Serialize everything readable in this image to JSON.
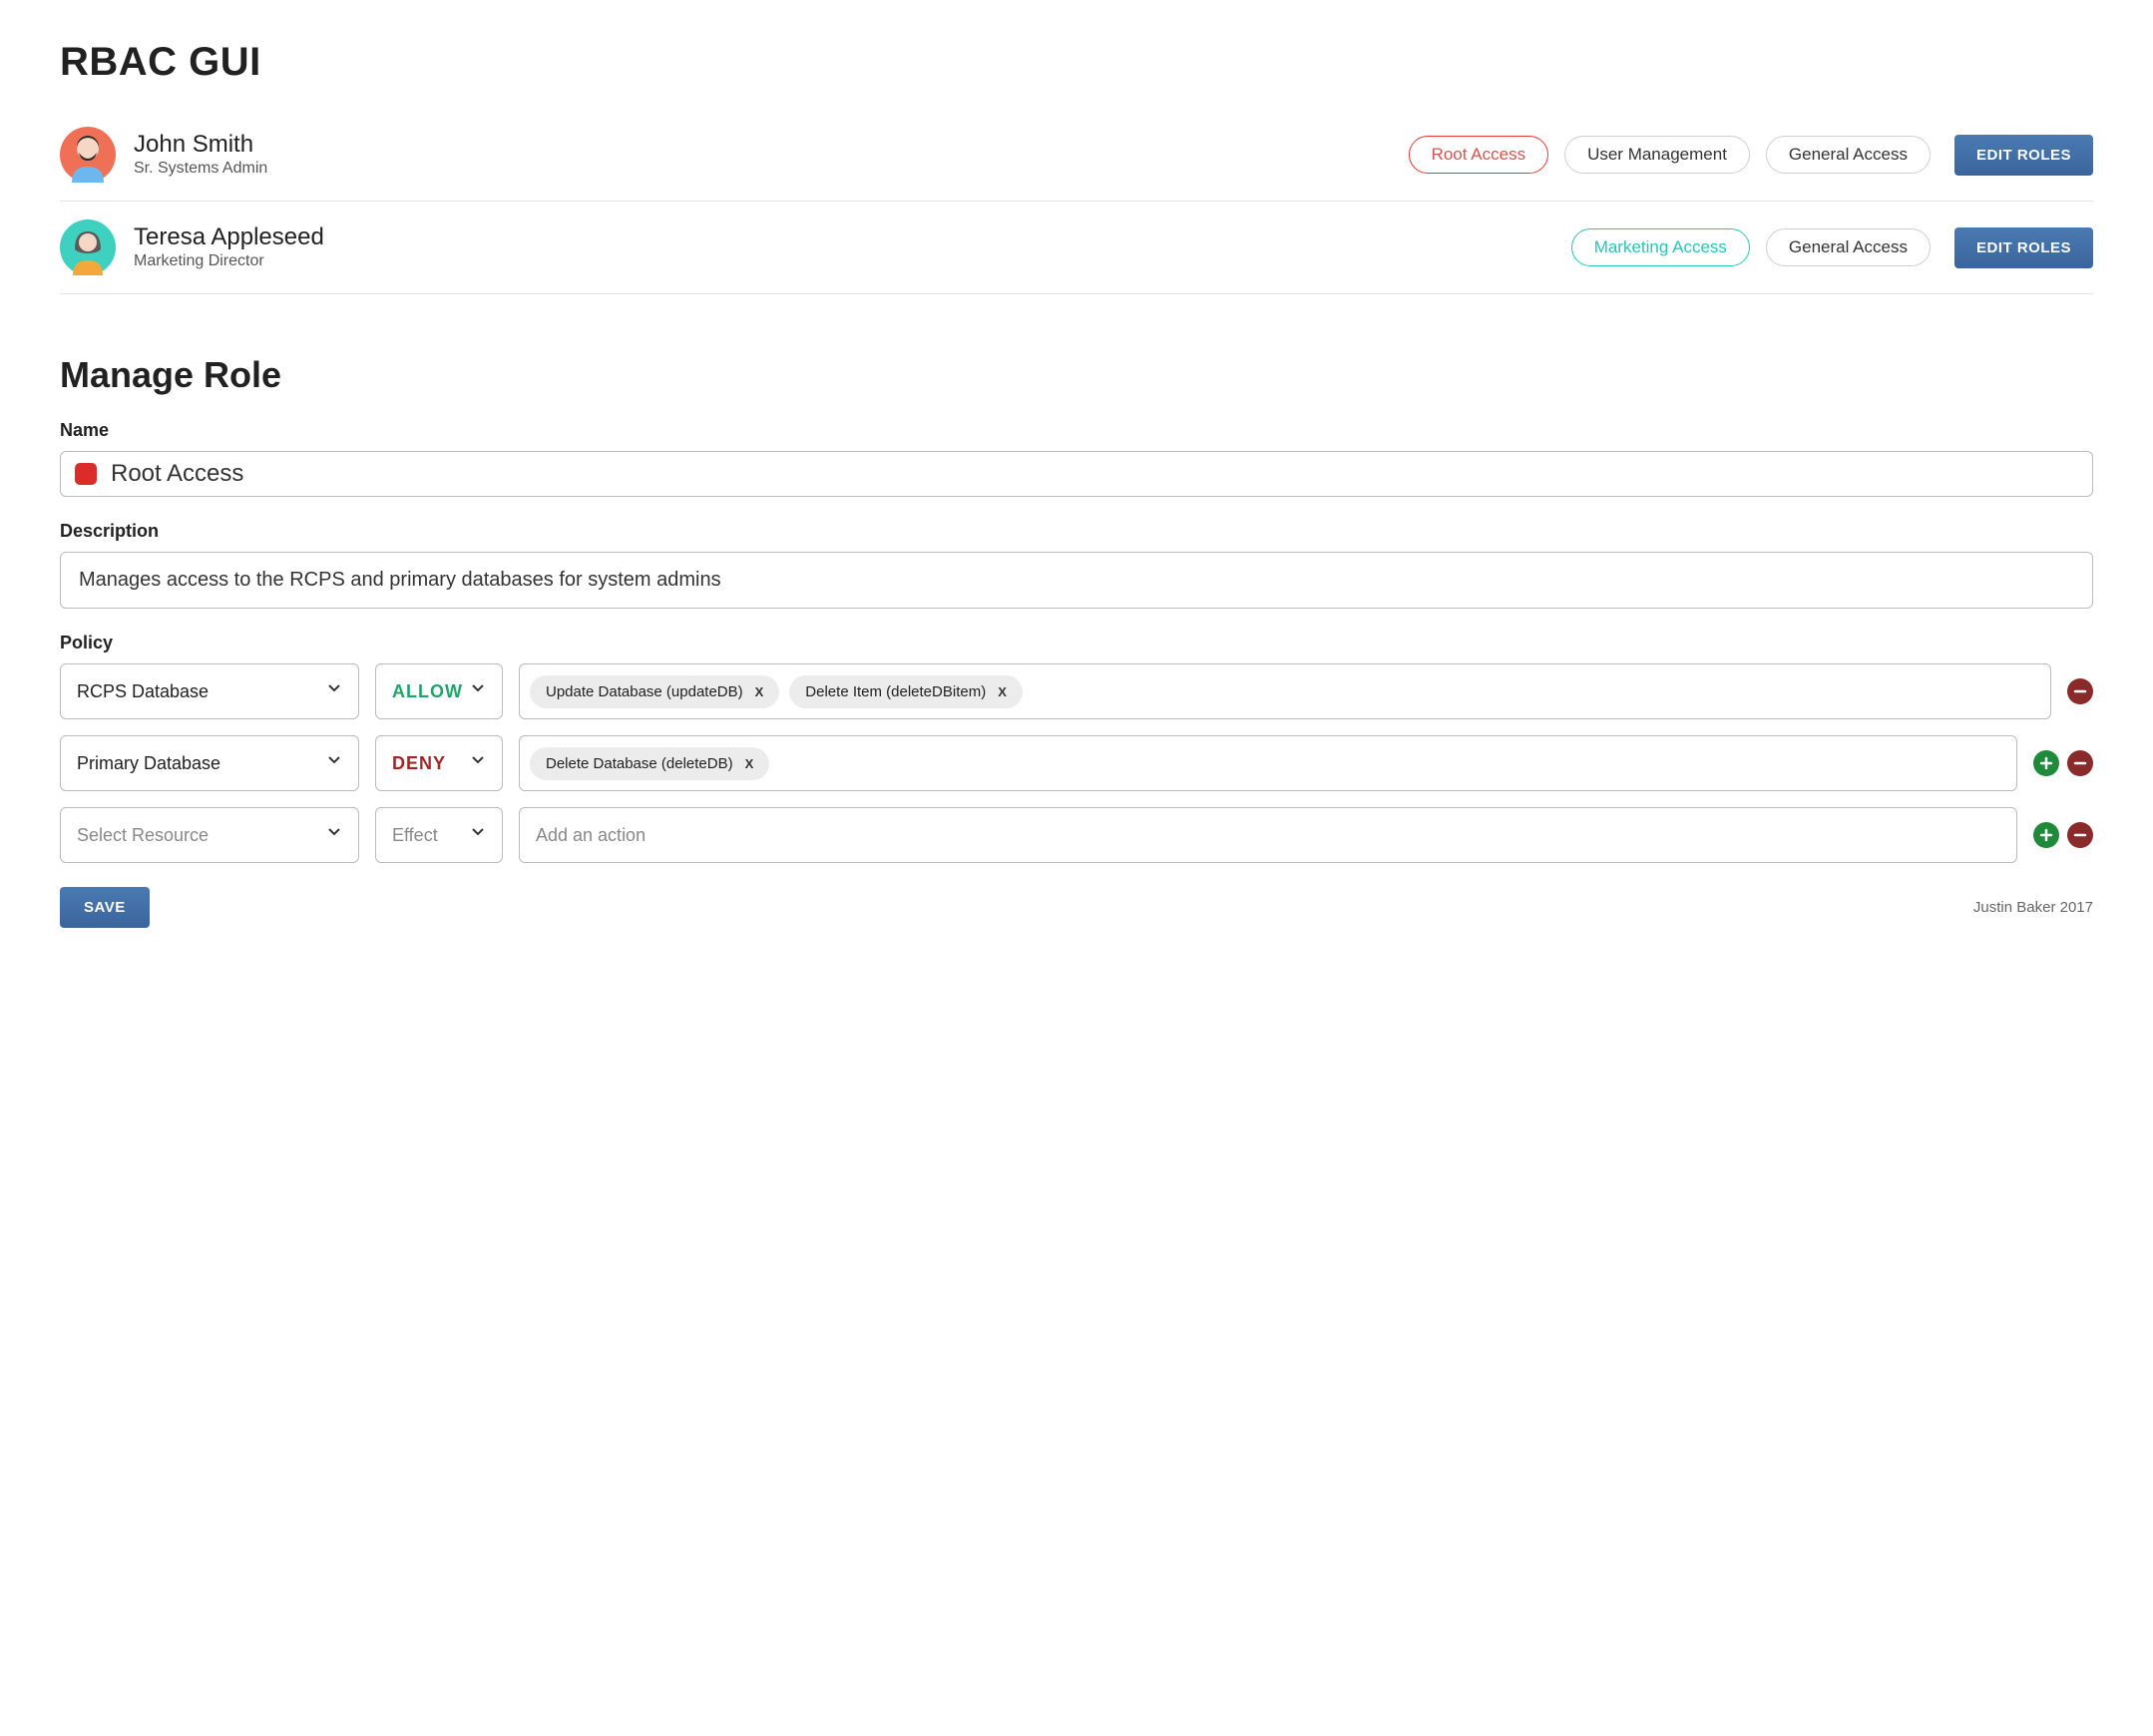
{
  "header": {
    "title": "RBAC GUI"
  },
  "users": [
    {
      "name": "John Smith",
      "title": "Sr. Systems Admin",
      "avatar_bg": "#f07055",
      "roles": [
        {
          "label": "Root Access",
          "variant": "red"
        },
        {
          "label": "User Management",
          "variant": ""
        },
        {
          "label": "General Access",
          "variant": ""
        }
      ]
    },
    {
      "name": "Teresa Appleseed",
      "title": "Marketing Director",
      "avatar_bg": "#3fd1c0",
      "roles": [
        {
          "label": "Marketing Access",
          "variant": "teal"
        },
        {
          "label": "General Access",
          "variant": ""
        }
      ]
    }
  ],
  "edit_roles_label": "EDIT ROLES",
  "manage_role": {
    "heading": "Manage Role",
    "name_label": "Name",
    "name_value": "Root Access",
    "name_color": "#dc2b2b",
    "description_label": "Description",
    "description_value": "Manages access to the RCPS and primary databases for system admins",
    "policy_label": "Policy",
    "policies": [
      {
        "resource": "RCPS Database",
        "resource_placeholder": false,
        "effect": "ALLOW",
        "effect_placeholder": false,
        "actions": [
          "Update Database (updateDB)",
          "Delete Item (deleteDBitem)"
        ],
        "show_add": false,
        "show_remove": true
      },
      {
        "resource": "Primary Database",
        "resource_placeholder": false,
        "effect": "DENY",
        "effect_placeholder": false,
        "actions": [
          "Delete Database (deleteDB)"
        ],
        "show_add": true,
        "show_remove": true
      },
      {
        "resource": "Select Resource",
        "resource_placeholder": true,
        "effect": "Effect",
        "effect_placeholder": true,
        "actions": [],
        "action_placeholder": "Add an action",
        "show_add": true,
        "show_remove": true
      }
    ]
  },
  "save_label": "SAVE",
  "attribution": "Justin Baker 2017"
}
